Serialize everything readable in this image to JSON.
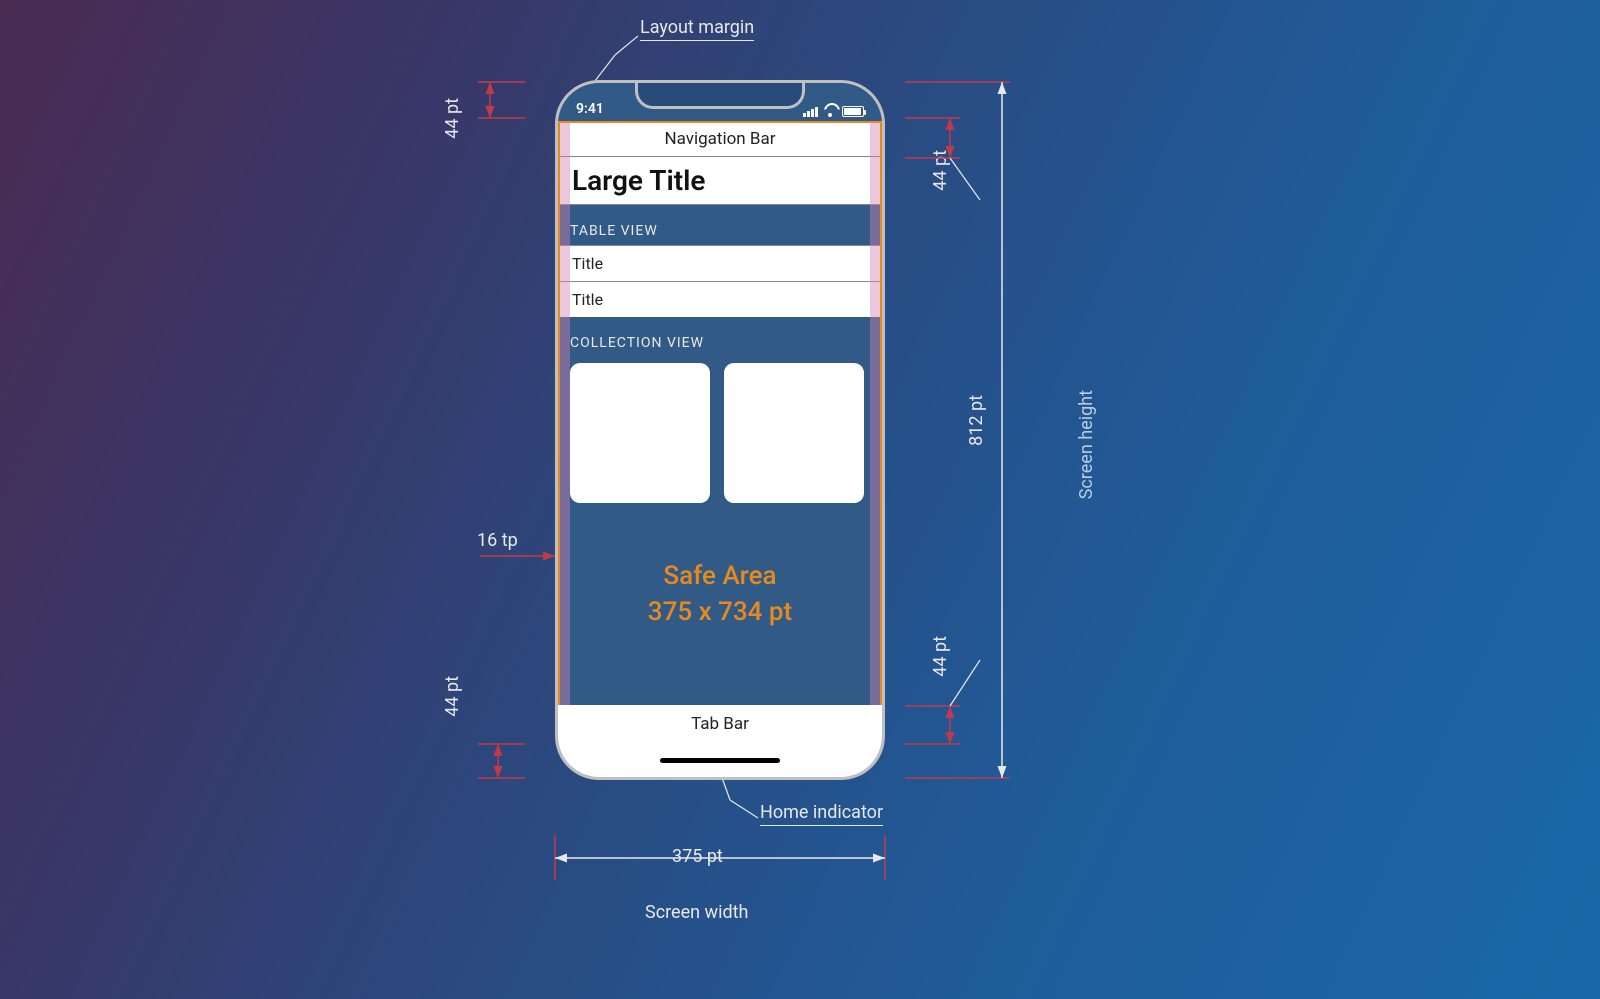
{
  "callouts": {
    "layout_margin": "Layout margin",
    "home_indicator": "Home indicator",
    "screen_width": "Screen width",
    "screen_height": "Screen height"
  },
  "dims": {
    "status_height": "44 pt",
    "nav_height": "44 pt",
    "tab_height": "44 pt",
    "bottom_margin": "44 pt",
    "side_margin": "16 tp",
    "screen_width": "375 pt",
    "screen_height": "812 pt"
  },
  "phone": {
    "status_time": "9:41",
    "nav_bar": "Navigation Bar",
    "large_title": "Large Title",
    "table_section": "TABLE VIEW",
    "table_rows": [
      "Title",
      "Title"
    ],
    "collection_section": "COLLECTION VIEW",
    "safe_area_title": "Safe Area",
    "safe_area_size": "375 x 734 pt",
    "tab_bar": "Tab Bar"
  },
  "colors": {
    "accent": "#e68a1f",
    "dim_line": "#c23a4a"
  }
}
